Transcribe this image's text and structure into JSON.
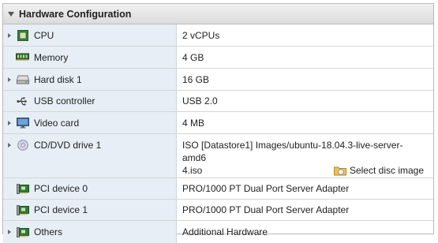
{
  "section": {
    "title": "Hardware Configuration"
  },
  "rows": [
    {
      "label": "CPU",
      "value": "2 vCPUs",
      "icon": "cpu-icon"
    },
    {
      "label": "Memory",
      "value": "4 GB",
      "icon": "memory-icon"
    },
    {
      "label": "Hard disk 1",
      "value": "16 GB",
      "icon": "hard-disk-icon"
    },
    {
      "label": "USB controller",
      "value": "USB 2.0",
      "icon": "usb-icon"
    },
    {
      "label": "Video card",
      "value": "4 MB",
      "icon": "monitor-icon"
    },
    {
      "label": "CD/DVD drive 1",
      "value_line1": "ISO [Datastore1] Images/ubuntu-18.04.3-live-server-amd6",
      "value_line2": "4.iso",
      "action": "Select disc image",
      "icon": "cd-dvd-icon"
    },
    {
      "label": "PCI device 0",
      "value": "PRO/1000 PT Dual Port Server Adapter",
      "icon": "pci-card-icon"
    },
    {
      "label": "PCI device 1",
      "value": "PRO/1000 PT Dual Port Server Adapter",
      "icon": "pci-card-icon"
    },
    {
      "label": "Others",
      "value": "Additional Hardware",
      "icon": "pci-card-icon"
    }
  ],
  "colors": {
    "label_bg": "#e7eef5",
    "header_bg": "#e4e4e4",
    "border": "#d6d6d6"
  }
}
